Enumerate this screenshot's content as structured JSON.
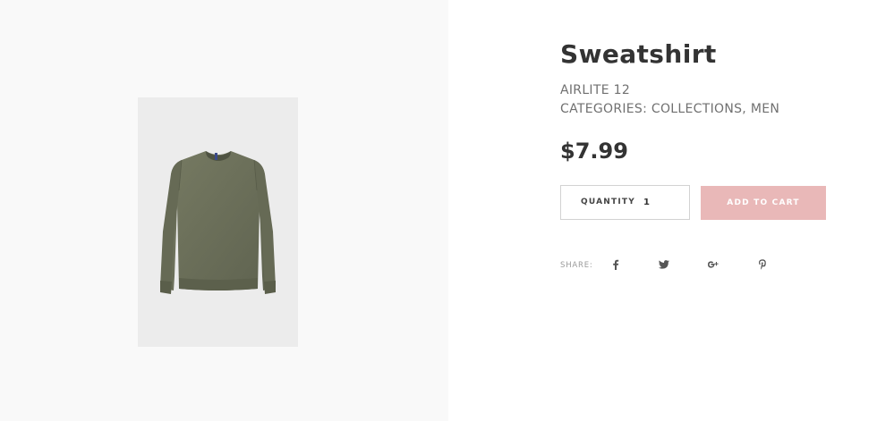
{
  "product": {
    "title": "Sweatshirt",
    "brand": "AIRLITE 12",
    "categories_label": "CATEGORIES:",
    "categories": [
      "COLLECTIONS",
      "MEN"
    ],
    "price": "$7.99",
    "image_alt": "Olive green crew-neck sweatshirt"
  },
  "purchase": {
    "quantity_label": "QUANTITY",
    "quantity_value": "1",
    "add_to_cart_label": "ADD TO CART",
    "button_color": "#e9b8b8"
  },
  "share": {
    "label": "SHARE:",
    "icons": [
      "facebook-icon",
      "twitter-icon",
      "google-plus-icon",
      "pinterest-icon"
    ]
  },
  "colors": {
    "gallery_background": "#f9f9f9",
    "photo_background": "#ececec",
    "sweatshirt": "#6b6f58",
    "text_dark": "#333333",
    "text_muted": "#707070"
  }
}
